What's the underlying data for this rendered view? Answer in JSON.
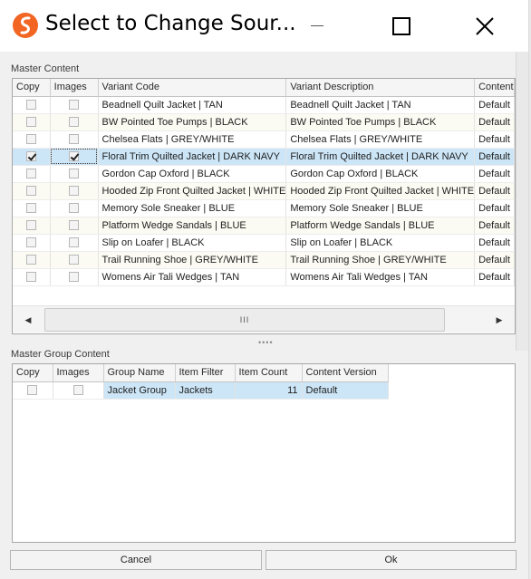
{
  "window": {
    "title": "Select to Change Sour...",
    "logo_colors": [
      "#f26522",
      "#ffffff"
    ]
  },
  "master": {
    "label": "Master Content",
    "columns": [
      "Copy",
      "Images",
      "Variant Code",
      "Variant Description",
      "Content"
    ],
    "rows": [
      {
        "copy": false,
        "images": false,
        "code": "Beadnell Quilt Jacket | TAN",
        "desc": "Beadnell Quilt Jacket | TAN",
        "content": "Default"
      },
      {
        "copy": false,
        "images": false,
        "code": "BW Pointed Toe Pumps | BLACK",
        "desc": "BW Pointed Toe Pumps | BLACK",
        "content": "Default"
      },
      {
        "copy": false,
        "images": false,
        "code": "Chelsea Flats | GREY/WHITE",
        "desc": "Chelsea Flats | GREY/WHITE",
        "content": "Default"
      },
      {
        "copy": true,
        "images": true,
        "code": "Floral Trim Quilted Jacket | DARK NAVY",
        "desc": "Floral Trim Quilted Jacket | DARK NAVY",
        "content": "Default",
        "selected": true
      },
      {
        "copy": false,
        "images": false,
        "code": "Gordon Cap Oxford | BLACK",
        "desc": "Gordon Cap Oxford | BLACK",
        "content": "Default"
      },
      {
        "copy": false,
        "images": false,
        "code": "Hooded Zip Front Quilted Jacket | WHITE",
        "desc": "Hooded Zip Front Quilted Jacket | WHITE",
        "content": "Default"
      },
      {
        "copy": false,
        "images": false,
        "code": "Memory Sole Sneaker | BLUE",
        "desc": "Memory Sole Sneaker | BLUE",
        "content": "Default"
      },
      {
        "copy": false,
        "images": false,
        "code": "Platform Wedge Sandals | BLUE",
        "desc": "Platform Wedge Sandals | BLUE",
        "content": "Default"
      },
      {
        "copy": false,
        "images": false,
        "code": "Slip on Loafer | BLACK",
        "desc": "Slip on Loafer | BLACK",
        "content": "Default"
      },
      {
        "copy": false,
        "images": false,
        "code": "Trail Running Shoe | GREY/WHITE",
        "desc": "Trail Running Shoe | GREY/WHITE",
        "content": "Default"
      },
      {
        "copy": false,
        "images": false,
        "code": "Womens Air Tali Wedges | TAN",
        "desc": "Womens Air Tali Wedges | TAN",
        "content": "Default"
      }
    ],
    "scroll_grip": "III"
  },
  "group": {
    "label": "Master Group Content",
    "columns": [
      "Copy",
      "Images",
      "Group Name",
      "Item Filter",
      "Item Count",
      "Content Version"
    ],
    "rows": [
      {
        "copy": false,
        "images": false,
        "name": "Jacket Group",
        "filter": "Jackets",
        "count": "11",
        "version": "Default",
        "selected": true
      }
    ]
  },
  "splitter_grip": "••••",
  "footer": {
    "cancel_label": "Cancel",
    "ok_label": "Ok"
  },
  "colors": {
    "selection": "#cde6f7",
    "alt_row": "#fbfbf3"
  }
}
